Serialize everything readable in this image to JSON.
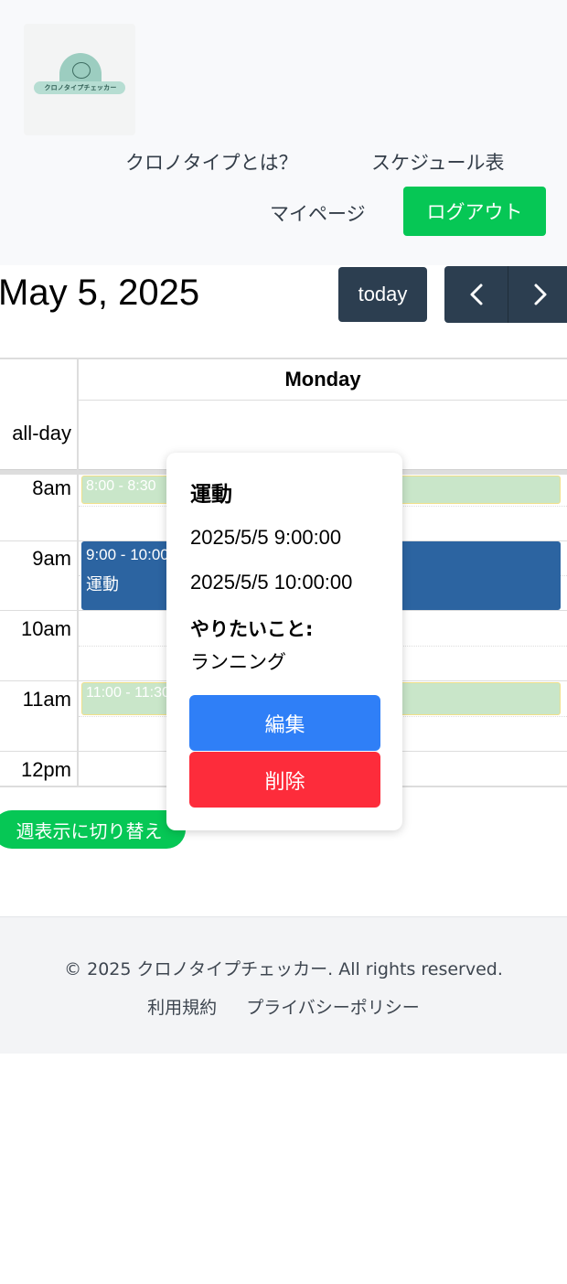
{
  "header": {
    "logo_text": "クロノタイプチェッカー",
    "nav_about": "クロノタイプとは？",
    "nav_schedule": "スケジュール表",
    "nav_mypage": "マイページ",
    "logout_label": "ログアウト",
    "accent_color": "#06c755"
  },
  "calendar": {
    "title": "May 5, 2025",
    "today_label": "today",
    "day_header": "Monday",
    "allday_label": "all-day",
    "time_labels": [
      "8am",
      "9am",
      "10am",
      "11am",
      "12pm"
    ],
    "events": [
      {
        "time": "8:00 - 8:30",
        "title": ""
      },
      {
        "time": "9:00 - 10:00",
        "title": "運動"
      },
      {
        "time": "11:00 - 11:30",
        "title": ""
      }
    ],
    "week_toggle_label": "週表示に切り替え"
  },
  "popover": {
    "title": "運動",
    "start": "2025/5/5 9:00:00",
    "end": "2025/5/5 10:00:00",
    "want_label": "やりたいこと:",
    "want_value": "ランニング",
    "edit_label": "編集",
    "delete_label": "削除"
  },
  "footer": {
    "copyright": "© 2025 クロノタイプチェッカー. All rights reserved.",
    "terms": "利用規約",
    "privacy": "プライバシーポリシー"
  }
}
